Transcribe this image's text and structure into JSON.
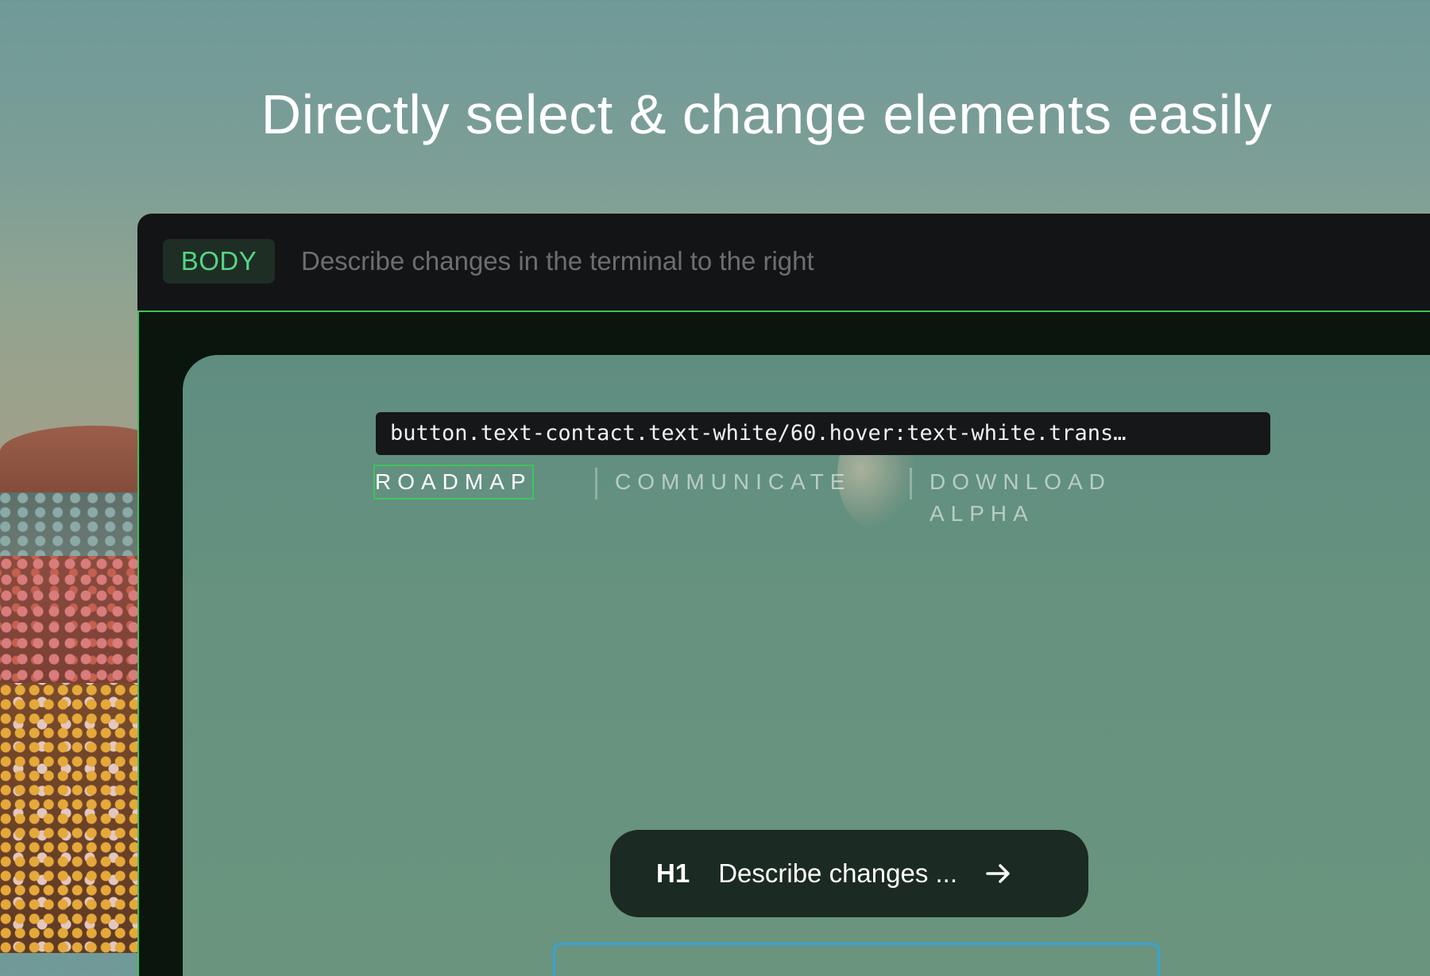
{
  "headline": "Directly select & change elements easily",
  "topbar": {
    "tag": "BODY",
    "prompt": "Describe changes in the terminal to the right"
  },
  "tooltip": "button.text-contact.text-white/60.hover:text-white.trans…",
  "nav": {
    "items": [
      "ROADMAP",
      "COMMUNICATE",
      "DOWNLOAD ALPHA"
    ]
  },
  "command": {
    "tag": "H1",
    "placeholder": "Describe changes ...",
    "submit_icon": "arrow-right-icon"
  },
  "colors": {
    "accent_green": "#3cc55b",
    "tag_green": "#56d486",
    "selection_blue": "#36a4d6"
  }
}
